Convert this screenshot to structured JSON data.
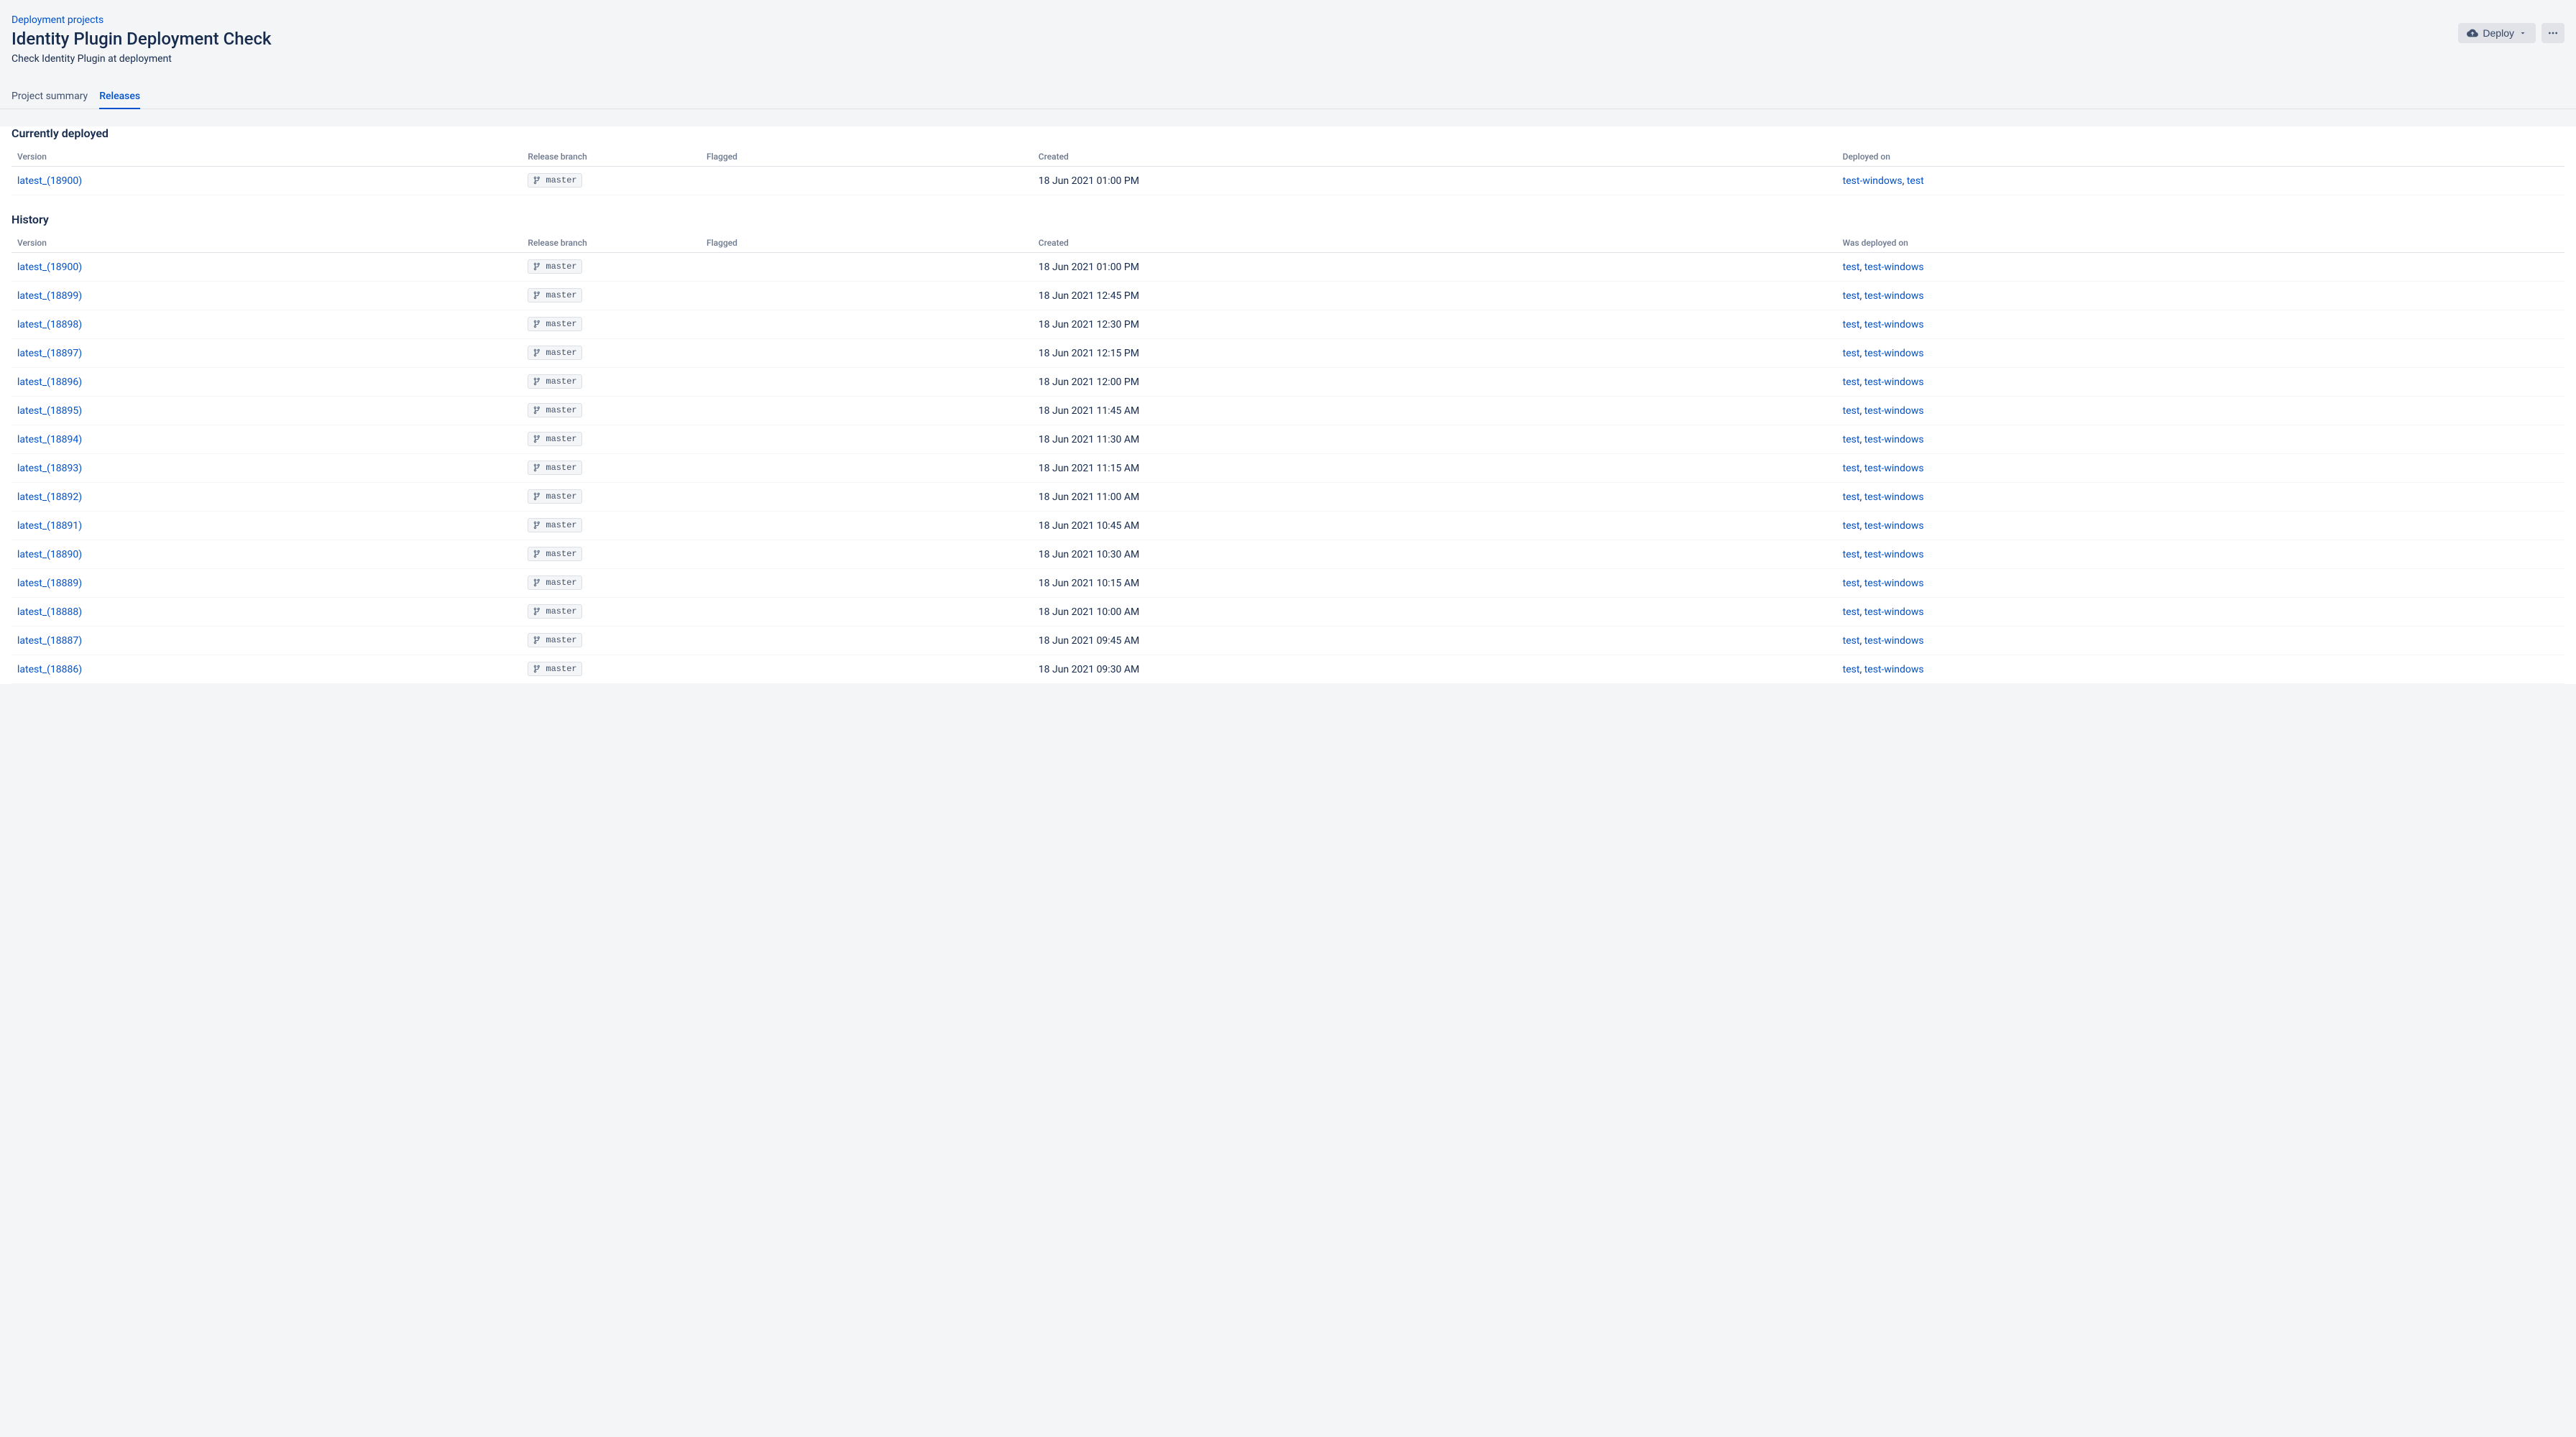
{
  "breadcrumb": {
    "label": "Deployment projects"
  },
  "page": {
    "title": "Identity Plugin Deployment Check",
    "subtitle": "Check Identity Plugin at deployment"
  },
  "actions": {
    "deploy_label": "Deploy"
  },
  "tabs": {
    "summary": "Project summary",
    "releases": "Releases"
  },
  "sections": {
    "currently_deployed": "Currently deployed",
    "history": "History"
  },
  "columns": {
    "version": "Version",
    "release_branch": "Release branch",
    "flagged": "Flagged",
    "created": "Created",
    "deployed_on": "Deployed on",
    "was_deployed_on": "Was deployed on"
  },
  "currently_deployed": {
    "rows": [
      {
        "version": "latest_(18900)",
        "branch": "master",
        "created": "18 Jun 2021 01:00 PM",
        "deployed_on_a": "test-windows",
        "sep": ", ",
        "deployed_on_b": "test"
      }
    ]
  },
  "history": {
    "rows": [
      {
        "version": "latest_(18900)",
        "branch": "master",
        "created": "18 Jun 2021 01:00 PM",
        "dep_a": "test",
        "sep": ", ",
        "dep_b": "test-windows"
      },
      {
        "version": "latest_(18899)",
        "branch": "master",
        "created": "18 Jun 2021 12:45 PM",
        "dep_a": "test",
        "sep": ", ",
        "dep_b": "test-windows"
      },
      {
        "version": "latest_(18898)",
        "branch": "master",
        "created": "18 Jun 2021 12:30 PM",
        "dep_a": "test",
        "sep": ", ",
        "dep_b": "test-windows"
      },
      {
        "version": "latest_(18897)",
        "branch": "master",
        "created": "18 Jun 2021 12:15 PM",
        "dep_a": "test",
        "sep": ", ",
        "dep_b": "test-windows"
      },
      {
        "version": "latest_(18896)",
        "branch": "master",
        "created": "18 Jun 2021 12:00 PM",
        "dep_a": "test",
        "sep": ", ",
        "dep_b": "test-windows"
      },
      {
        "version": "latest_(18895)",
        "branch": "master",
        "created": "18 Jun 2021 11:45 AM",
        "dep_a": "test",
        "sep": ", ",
        "dep_b": "test-windows"
      },
      {
        "version": "latest_(18894)",
        "branch": "master",
        "created": "18 Jun 2021 11:30 AM",
        "dep_a": "test",
        "sep": ", ",
        "dep_b": "test-windows"
      },
      {
        "version": "latest_(18893)",
        "branch": "master",
        "created": "18 Jun 2021 11:15 AM",
        "dep_a": "test",
        "sep": ", ",
        "dep_b": "test-windows"
      },
      {
        "version": "latest_(18892)",
        "branch": "master",
        "created": "18 Jun 2021 11:00 AM",
        "dep_a": "test",
        "sep": ", ",
        "dep_b": "test-windows"
      },
      {
        "version": "latest_(18891)",
        "branch": "master",
        "created": "18 Jun 2021 10:45 AM",
        "dep_a": "test",
        "sep": ", ",
        "dep_b": "test-windows"
      },
      {
        "version": "latest_(18890)",
        "branch": "master",
        "created": "18 Jun 2021 10:30 AM",
        "dep_a": "test",
        "sep": ", ",
        "dep_b": "test-windows"
      },
      {
        "version": "latest_(18889)",
        "branch": "master",
        "created": "18 Jun 2021 10:15 AM",
        "dep_a": "test",
        "sep": ", ",
        "dep_b": "test-windows"
      },
      {
        "version": "latest_(18888)",
        "branch": "master",
        "created": "18 Jun 2021 10:00 AM",
        "dep_a": "test",
        "sep": ", ",
        "dep_b": "test-windows"
      },
      {
        "version": "latest_(18887)",
        "branch": "master",
        "created": "18 Jun 2021 09:45 AM",
        "dep_a": "test",
        "sep": ", ",
        "dep_b": "test-windows"
      },
      {
        "version": "latest_(18886)",
        "branch": "master",
        "created": "18 Jun 2021 09:30 AM",
        "dep_a": "test",
        "sep": ", ",
        "dep_b": "test-windows"
      }
    ]
  }
}
